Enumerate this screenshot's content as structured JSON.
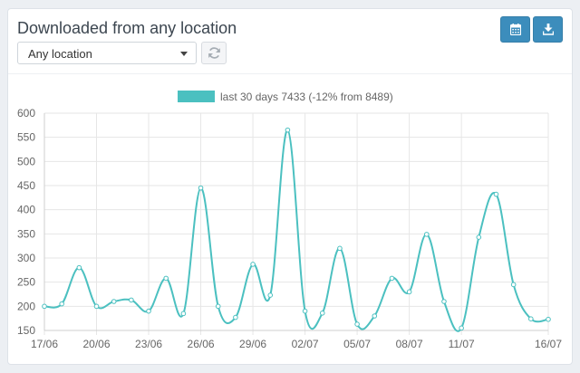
{
  "panel": {
    "title": "Downloaded from any location",
    "location_select": {
      "selected": "Any location"
    },
    "icons": {
      "refresh": "refresh-icon",
      "calendar": "calendar-icon",
      "download": "download-icon"
    },
    "colors": {
      "button": "#3c8dbc",
      "series": "#4bc0c0"
    }
  },
  "chart_data": {
    "type": "line",
    "legend_label": "last 30 days 7433 (-12% from 8489)",
    "legend_position": "top",
    "grid": true,
    "ylim": [
      150,
      600
    ],
    "y_ticks": [
      150,
      200,
      250,
      300,
      350,
      400,
      450,
      500,
      550,
      600
    ],
    "x_tick_labels": [
      "17/06",
      "20/06",
      "23/06",
      "26/06",
      "29/06",
      "02/07",
      "05/07",
      "08/07",
      "11/07",
      "16/07"
    ],
    "series": [
      {
        "name": "last 30 days",
        "x": [
          "17/06",
          "18/06",
          "19/06",
          "20/06",
          "21/06",
          "22/06",
          "23/06",
          "24/06",
          "25/06",
          "26/06",
          "27/06",
          "28/06",
          "29/06",
          "30/06",
          "01/07",
          "02/07",
          "03/07",
          "04/07",
          "05/07",
          "06/07",
          "07/07",
          "08/07",
          "09/07",
          "10/07",
          "11/07",
          "12/07",
          "13/07",
          "14/07",
          "15/07",
          "16/07"
        ],
        "values": [
          200,
          205,
          280,
          200,
          210,
          213,
          190,
          258,
          185,
          445,
          200,
          177,
          287,
          223,
          565,
          190,
          186,
          320,
          163,
          180,
          258,
          230,
          349,
          210,
          155,
          343,
          432,
          245,
          174,
          173
        ]
      }
    ]
  }
}
